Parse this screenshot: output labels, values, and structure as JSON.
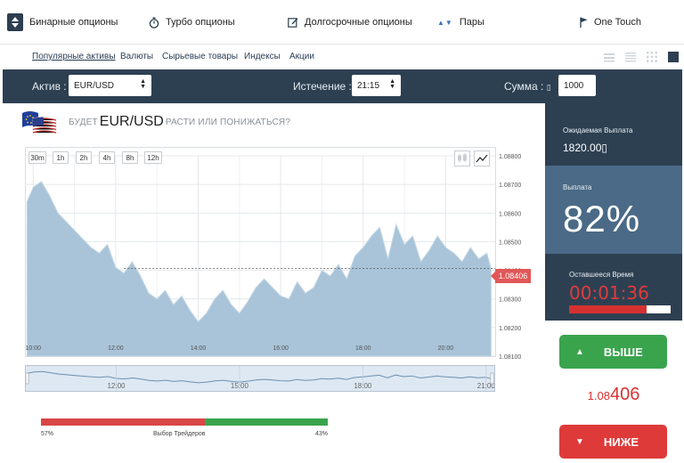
{
  "tabs": [
    {
      "label": "Бинарные опционы",
      "active": true
    },
    {
      "label": "Турбо опционы"
    },
    {
      "label": "Долгосрочные опционы"
    },
    {
      "label": "Пары"
    },
    {
      "label": "One Touch"
    }
  ],
  "subnav": {
    "items": [
      "Популярные активы",
      "Валюты",
      "Сырьевые товары",
      "Индексы",
      "Акции"
    ]
  },
  "controls": {
    "asset_label": "Актив :",
    "asset_value": "EUR/USD",
    "expiry_label": "Истечение :",
    "expiry_value": "21:15",
    "amount_label": "Сумма : ",
    "amount_currency": "▯",
    "amount_value": "1000"
  },
  "question": {
    "prefix": "БУДЕТ",
    "pair": "EUR/USD",
    "suffix": "РАСТИ ИЛИ ПОНИЖАТЬСЯ?"
  },
  "chart": {
    "ranges": [
      "30m",
      "1h",
      "2h",
      "4h",
      "8h",
      "12h"
    ],
    "current_price": "1.08406",
    "colors": {
      "area": "#a9c4d8",
      "area_line": "#c5d8e6",
      "grid": "#e4e8ec"
    }
  },
  "chart_data": {
    "type": "area",
    "title": "",
    "xlabel": "",
    "ylabel": "",
    "x_ticks": [
      "10:00",
      "12:00",
      "14:00",
      "16:00",
      "18:00",
      "20:00"
    ],
    "y_ticks": [
      "1.08800",
      "1.08700",
      "1.08600",
      "1.08500",
      "1.08400",
      "1.08300",
      "1.08200",
      "1.08100"
    ],
    "ylim": [
      1.081,
      1.088
    ],
    "xlim": [
      9.8,
      21.2
    ],
    "grid": true,
    "current_price": 1.08406,
    "series": [
      {
        "x": [
          9.85,
          10.0,
          10.2,
          10.4,
          10.6,
          10.8,
          11.0,
          11.2,
          11.4,
          11.6,
          11.8,
          12.0,
          12.2,
          12.4,
          12.6,
          12.8,
          13.0,
          13.2,
          13.4,
          13.6,
          13.8,
          14.0,
          14.2,
          14.4,
          14.6,
          14.8,
          15.0,
          15.2,
          15.4,
          15.6,
          15.8,
          16.0,
          16.2,
          16.4,
          16.6,
          16.8,
          17.0,
          17.2,
          17.4,
          17.6,
          17.8,
          18.0,
          18.2,
          18.4,
          18.6,
          18.8,
          19.0,
          19.2,
          19.4,
          19.6,
          19.8,
          20.0,
          20.2,
          20.4,
          20.6,
          20.8,
          21.0,
          21.1
        ],
        "y": [
          1.0864,
          1.0869,
          1.0871,
          1.0866,
          1.086,
          1.0857,
          1.0854,
          1.0851,
          1.0848,
          1.0846,
          1.0849,
          1.0841,
          1.0839,
          1.0843,
          1.0838,
          1.0832,
          1.083,
          1.0833,
          1.0828,
          1.0831,
          1.0826,
          1.0822,
          1.0825,
          1.083,
          1.0833,
          1.0828,
          1.0825,
          1.0829,
          1.0834,
          1.0837,
          1.0834,
          1.0831,
          1.083,
          1.0836,
          1.0832,
          1.0834,
          1.084,
          1.0838,
          1.0842,
          1.0837,
          1.0845,
          1.0848,
          1.0852,
          1.0855,
          1.0844,
          1.0856,
          1.0849,
          1.0852,
          1.0843,
          1.0847,
          1.0852,
          1.0848,
          1.0846,
          1.0843,
          1.0848,
          1.0844,
          1.0846,
          1.08406
        ]
      }
    ],
    "navigator_ticks": [
      "12:00",
      "15:00",
      "18:00",
      "21:00"
    ]
  },
  "traders": {
    "label": "Выбор Трейдеров",
    "put_pct": "57%",
    "call_pct": "43%",
    "put_value": 57,
    "call_value": 43
  },
  "panel": {
    "payout_expected_label": "Ожидаемая Выплата",
    "payout_expected_value": "1820.00▯",
    "payout_label": "Выплата",
    "payout_pct": "82%",
    "time_left_label": "Оставшееся Время",
    "time_left_value": "00:01:36",
    "time_left_progress": 0.76,
    "btn_up": "ВЫШЕ",
    "btn_down": "НИЖЕ",
    "price_small": "1.08",
    "price_big": "406"
  }
}
